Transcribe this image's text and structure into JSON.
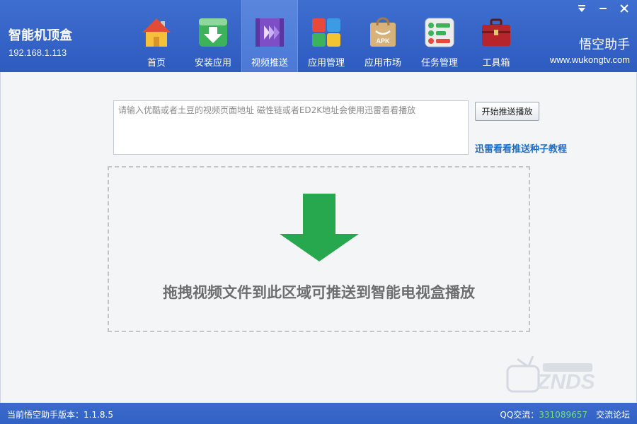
{
  "device": {
    "title": "智能机顶盒",
    "ip": "192.168.1.113"
  },
  "window_controls": [
    {
      "name": "menu-dropdown",
      "icon": "chevron-down-icon"
    },
    {
      "name": "minimize",
      "icon": "minimize-icon"
    },
    {
      "name": "close",
      "icon": "close-icon"
    }
  ],
  "nav": {
    "active_index": 2,
    "items": [
      {
        "label": "首页",
        "icon": "home-icon"
      },
      {
        "label": "安装应用",
        "icon": "install-download-icon"
      },
      {
        "label": "视频推送",
        "icon": "video-push-icon"
      },
      {
        "label": "应用管理",
        "icon": "app-manage-icon"
      },
      {
        "label": "应用市场",
        "icon": "apk-market-icon"
      },
      {
        "label": "任务管理",
        "icon": "task-manage-icon"
      },
      {
        "label": "工具箱",
        "icon": "toolbox-icon"
      }
    ]
  },
  "brand": {
    "name": "悟空助手",
    "url": "www.wukongtv.com"
  },
  "push": {
    "input_placeholder": "请输入优酷或者土豆的视频页面地址 磁性链或者ED2K地址会使用迅雷看看播放",
    "input_value": "",
    "button_label": "开始推送播放",
    "tutorial_link": "迅雷看看推送种子教程"
  },
  "dropzone": {
    "text": "拖拽视频文件到此区域可推送到智能电视盒播放",
    "arrow_color": "#27a84f"
  },
  "footer": {
    "version_label": "当前悟空助手版本：1.1.8.5",
    "qq_label": "QQ交流：",
    "qq_number": "331089657",
    "forum_link": "交流论坛"
  },
  "colors": {
    "header_blue": "#3563c6",
    "active_tab": "#4b79d6",
    "link_blue": "#1f6fc6",
    "arrow_green": "#27a84f",
    "qq_green": "#6ee07a"
  }
}
